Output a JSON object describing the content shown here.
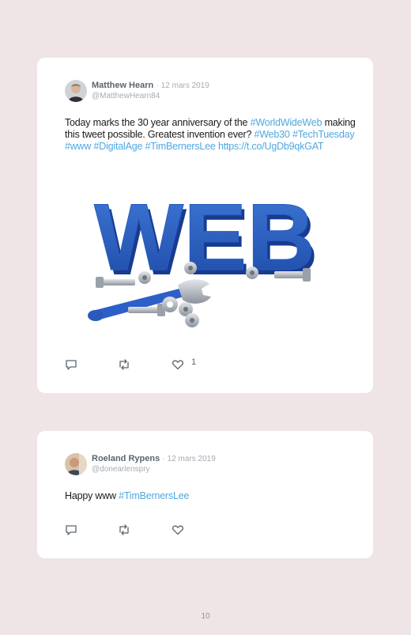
{
  "tweets": [
    {
      "author": "Matthew Hearn",
      "separator": "·",
      "date": "12 mars 2019",
      "handle": "@MatthewHearn84",
      "text_1": "Today marks the 30 year anniversary of the ",
      "tag_worldwideweb": "#WorldWideWeb",
      "text_2": " making this tweet possible. Greatest invention ever? ",
      "tag_web30": "#Web30",
      "tag_techtuesday": "#TechTuesday",
      "tag_www": "#www",
      "tag_digitalage": "#DigitalAge",
      "tag_timbernerslee": "#TimBernersLee",
      "url": "https://t.co/UgDb9qkGAT",
      "media_text": "WEB",
      "like_count": "1"
    },
    {
      "author": "Roeland Rypens",
      "separator": "·",
      "date": "12 mars 2019",
      "handle": "@donearlenspry",
      "text_1": "Happy www ",
      "tag_timbernerslee": "#TimBernersLee"
    }
  ],
  "page_number": "10",
  "colors": {
    "background": "#efe5e6",
    "link": "#4fa8e0",
    "card": "#ffffff"
  },
  "icons": [
    "reply-icon",
    "retweet-icon",
    "heart-icon"
  ]
}
